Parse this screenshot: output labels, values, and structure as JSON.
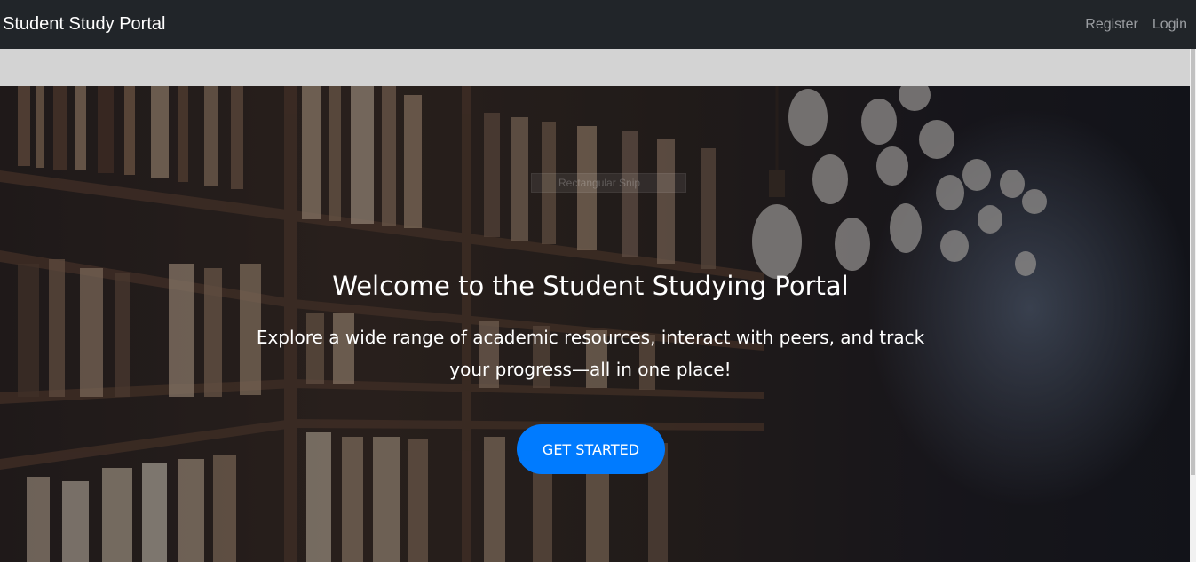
{
  "navbar": {
    "brand": "Student Study Portal",
    "links": [
      {
        "label": "Register"
      },
      {
        "label": "Login"
      }
    ]
  },
  "hero": {
    "ghost_label": "Rectangular Snip",
    "title": "Welcome to the Student Studying Portal",
    "description": "Explore a wide range of academic resources, interact with peers, and track your progress—all in one place!",
    "cta_label": "GET STARTED"
  },
  "colors": {
    "navbar_bg": "#212529",
    "strip_bg": "#d3d3d3",
    "cta_bg": "#007bff",
    "nav_link": "#9a9da1"
  },
  "icons": [
    "lightbulb-decor"
  ]
}
